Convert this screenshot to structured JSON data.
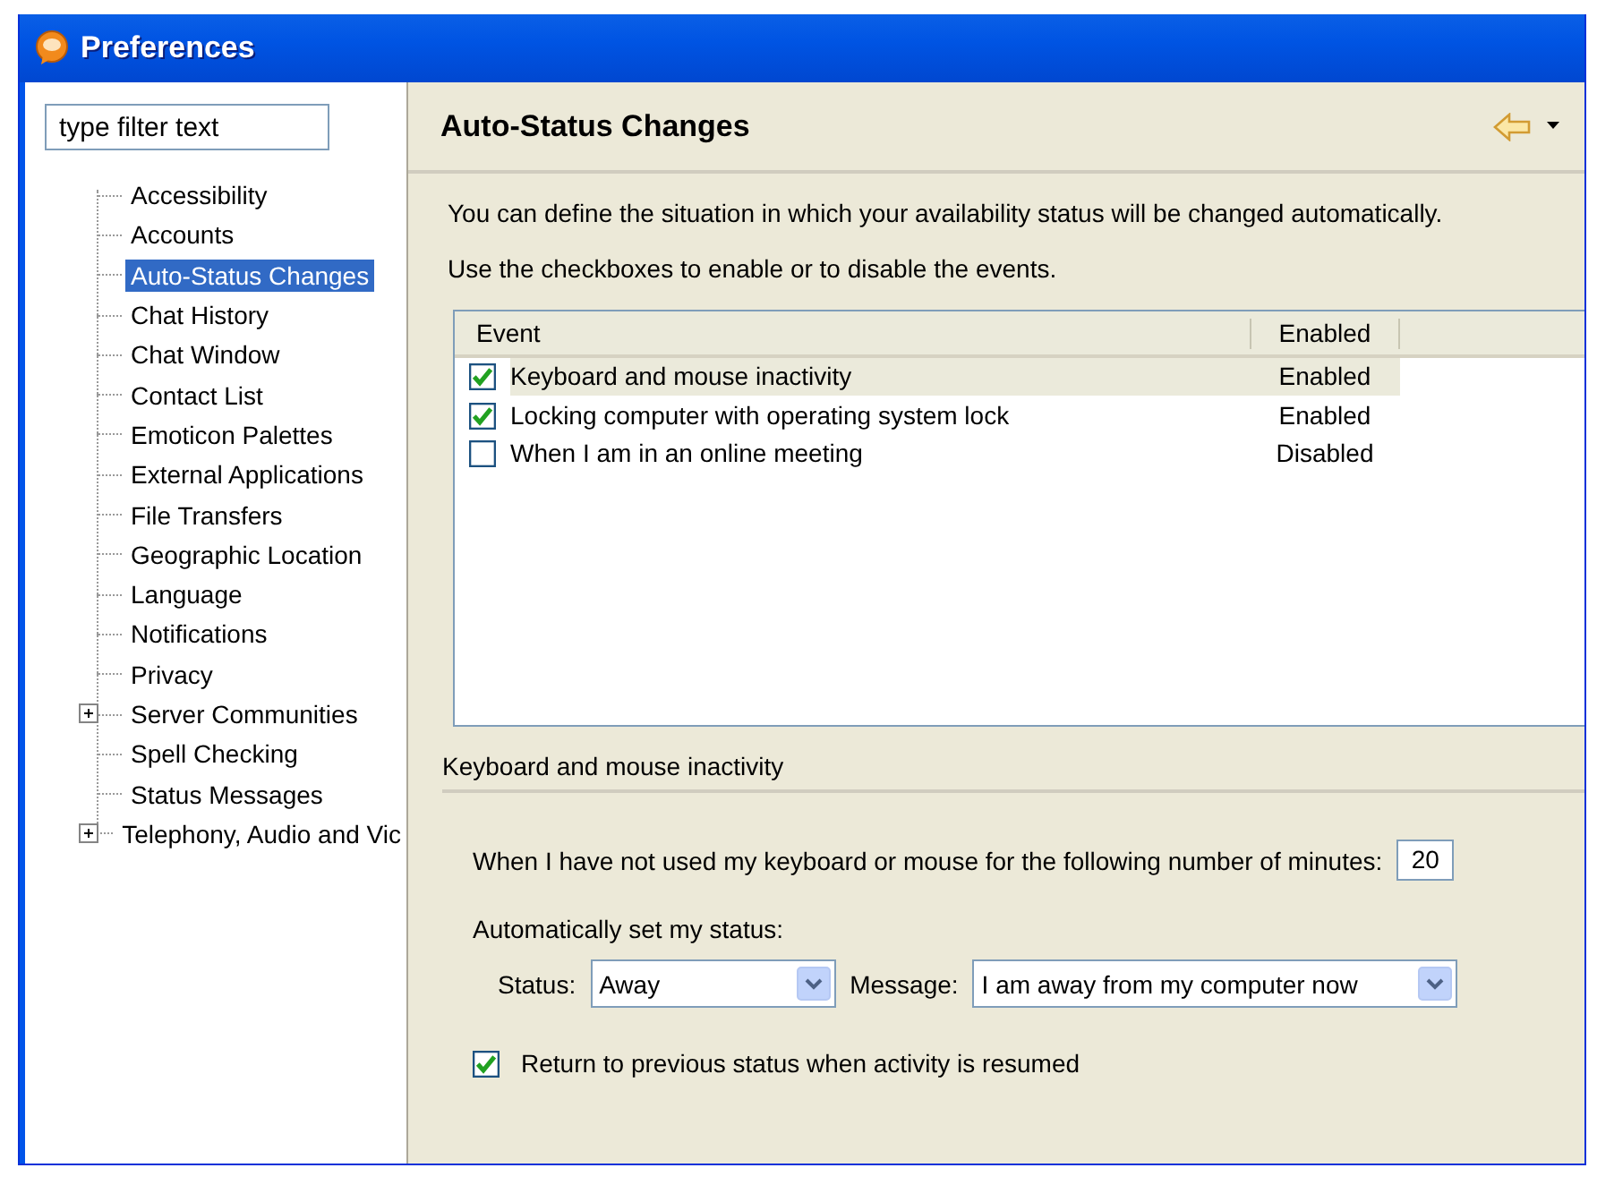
{
  "window": {
    "title": "Preferences"
  },
  "filter": {
    "placeholder": "type filter text"
  },
  "tree": [
    {
      "label": "Accessibility",
      "selected": false
    },
    {
      "label": "Accounts",
      "selected": false
    },
    {
      "label": "Auto-Status Changes",
      "selected": true
    },
    {
      "label": "Chat History",
      "selected": false
    },
    {
      "label": "Chat Window",
      "selected": false
    },
    {
      "label": "Contact List",
      "selected": false
    },
    {
      "label": "Emoticon Palettes",
      "selected": false
    },
    {
      "label": "External Applications",
      "selected": false
    },
    {
      "label": "File Transfers",
      "selected": false
    },
    {
      "label": "Geographic Location",
      "selected": false
    },
    {
      "label": "Language",
      "selected": false
    },
    {
      "label": "Notifications",
      "selected": false
    },
    {
      "label": "Privacy",
      "selected": false
    },
    {
      "label": "Server Communities",
      "selected": false,
      "expanded": false
    },
    {
      "label": "Spell Checking",
      "selected": false
    },
    {
      "label": "Status Messages",
      "selected": false
    },
    {
      "label": "Telephony, Audio and Vic",
      "selected": false,
      "expanded": false
    }
  ],
  "page": {
    "title": "Auto-Status Changes",
    "description": "You can define the situation in which your availability status will be changed automatically.",
    "hint": "Use the checkboxes to enable or to disable the events."
  },
  "table": {
    "columns": [
      "Event",
      "Enabled"
    ],
    "rows": [
      {
        "event": "Keyboard and mouse inactivity",
        "enabled": "Enabled",
        "checked": true,
        "selected": true
      },
      {
        "event": "Locking computer with operating system lock",
        "enabled": "Enabled",
        "checked": true,
        "selected": false
      },
      {
        "event": "When I am in an online meeting",
        "enabled": "Disabled",
        "checked": false,
        "selected": false
      }
    ]
  },
  "section": {
    "title": "Keyboard and mouse inactivity",
    "minutes_label": "When I have not used my keyboard or mouse for the following number of minutes:",
    "minutes": "20",
    "auto_label": "Automatically set my status:",
    "status_label": "Status:",
    "status": "Away",
    "message_label": "Message:",
    "message": "I am away from my computer now",
    "return_label": "Return to previous status when activity is resumed",
    "return_checked": true
  }
}
